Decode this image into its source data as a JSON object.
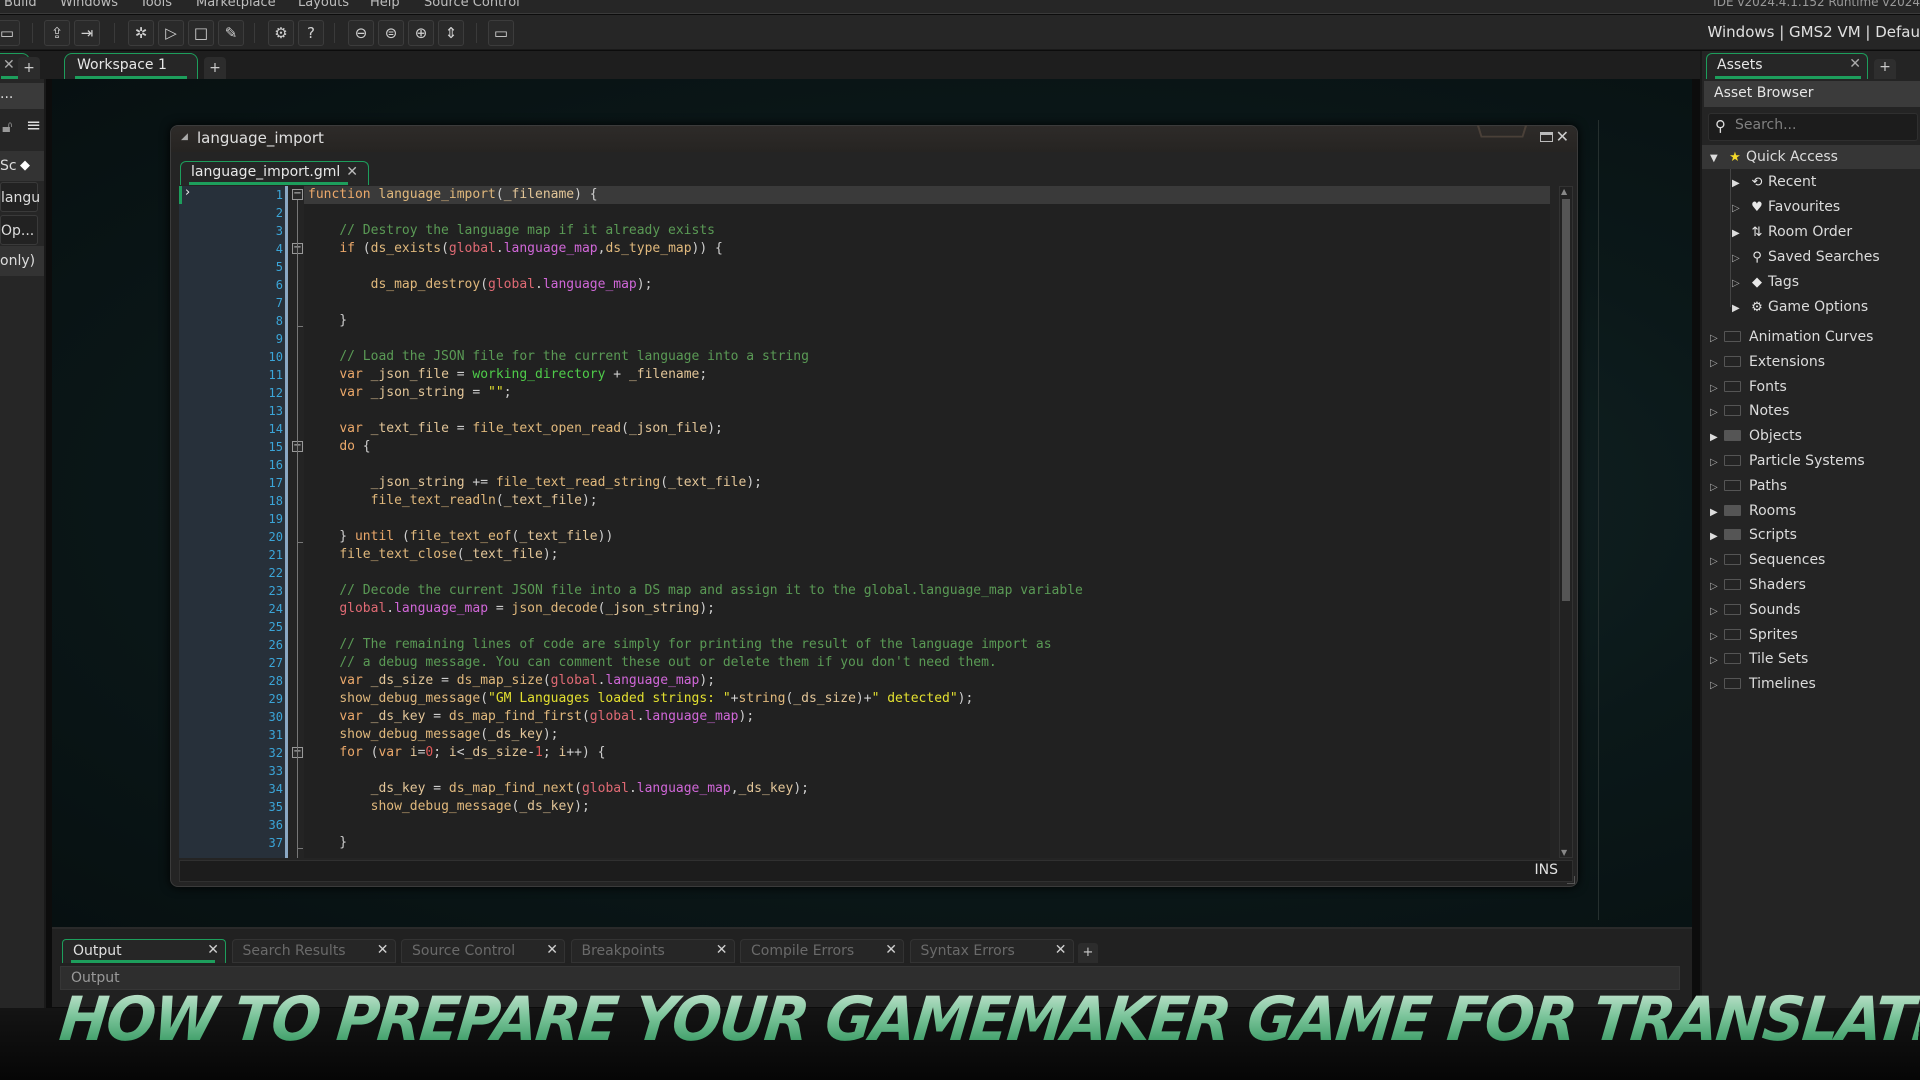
{
  "menu": {
    "items": [
      "Build",
      "Windows",
      "Tools",
      "Marketplace",
      "Layouts",
      "Help",
      "Source Control"
    ],
    "version_text": "IDE v2024.4.1.152  Runtime v2024"
  },
  "toolbar": {
    "buttons": [
      {
        "name": "save-icon",
        "glyph": "▭"
      },
      {
        "name": "export-icon",
        "glyph": "⇪"
      },
      {
        "name": "import-icon",
        "glyph": "⇥"
      },
      {
        "name": "debug-icon",
        "glyph": "✲"
      },
      {
        "name": "run-icon",
        "glyph": "▷"
      },
      {
        "name": "stop-icon",
        "glyph": "□"
      },
      {
        "name": "clean-icon",
        "glyph": "✎"
      },
      {
        "name": "settings-icon",
        "glyph": "⚙"
      },
      {
        "name": "help-icon",
        "glyph": "?"
      },
      {
        "name": "zoom-out-icon",
        "glyph": "⊖"
      },
      {
        "name": "zoom-reset-icon",
        "glyph": "⊜"
      },
      {
        "name": "zoom-in-icon",
        "glyph": "⊕"
      },
      {
        "name": "fit-icon",
        "glyph": "⇕"
      },
      {
        "name": "target-device-icon",
        "glyph": "▭"
      }
    ],
    "target_text": "Windows | GMS2 VM | Defau"
  },
  "tabs": {
    "workspace": "Workspace 1",
    "plus": "+"
  },
  "left_panel": {
    "search_fragment": "...",
    "rows": [
      "Sc",
      "langu",
      "Op...",
      "only)"
    ]
  },
  "code_window": {
    "title": "language_import",
    "file_tab": "language_import.gml",
    "close": "✕",
    "status": "INS",
    "lines": [
      [
        [
          "kw",
          "function "
        ],
        [
          "fn",
          "language_import"
        ],
        [
          "op",
          "("
        ],
        [
          "id",
          "_filename"
        ],
        [
          "op",
          ") {"
        ]
      ],
      [],
      [
        [
          "op",
          "    "
        ],
        [
          "cm",
          "// Destroy the language map if it already exists"
        ]
      ],
      [
        [
          "op",
          "    "
        ],
        [
          "kw",
          "if "
        ],
        [
          "op",
          "("
        ],
        [
          "fn",
          "ds_exists"
        ],
        [
          "op",
          "("
        ],
        [
          "gl",
          "global"
        ],
        [
          "op",
          "."
        ],
        [
          "gv",
          "language_map"
        ],
        [
          "op",
          ","
        ],
        [
          "fn",
          "ds_type_map"
        ],
        [
          "op",
          ")) {"
        ]
      ],
      [],
      [
        [
          "op",
          "        "
        ],
        [
          "fn",
          "ds_map_destroy"
        ],
        [
          "op",
          "("
        ],
        [
          "gl",
          "global"
        ],
        [
          "op",
          "."
        ],
        [
          "gv",
          "language_map"
        ],
        [
          "op",
          ");"
        ]
      ],
      [],
      [
        [
          "op",
          "    }"
        ]
      ],
      [],
      [
        [
          "op",
          "    "
        ],
        [
          "cm",
          "// Load the JSON file for the current language into a string"
        ]
      ],
      [
        [
          "op",
          "    "
        ],
        [
          "kw",
          "var "
        ],
        [
          "id",
          "_json_file"
        ],
        [
          "op",
          " = "
        ],
        [
          "bi",
          "working_directory"
        ],
        [
          "op",
          " + "
        ],
        [
          "id",
          "_filename"
        ],
        [
          "op",
          ";"
        ]
      ],
      [
        [
          "op",
          "    "
        ],
        [
          "kw",
          "var "
        ],
        [
          "id",
          "_json_string"
        ],
        [
          "op",
          " = "
        ],
        [
          "st",
          "\"\""
        ],
        [
          "op",
          ";"
        ]
      ],
      [],
      [
        [
          "op",
          "    "
        ],
        [
          "kw",
          "var "
        ],
        [
          "id",
          "_text_file"
        ],
        [
          "op",
          " = "
        ],
        [
          "fn",
          "file_text_open_read"
        ],
        [
          "op",
          "("
        ],
        [
          "id",
          "_json_file"
        ],
        [
          "op",
          ");"
        ]
      ],
      [
        [
          "op",
          "    "
        ],
        [
          "kw",
          "do "
        ],
        [
          "op",
          "{"
        ]
      ],
      [],
      [
        [
          "op",
          "        "
        ],
        [
          "id",
          "_json_string"
        ],
        [
          "op",
          " += "
        ],
        [
          "fn",
          "file_text_read_string"
        ],
        [
          "op",
          "("
        ],
        [
          "id",
          "_text_file"
        ],
        [
          "op",
          ");"
        ]
      ],
      [
        [
          "op",
          "        "
        ],
        [
          "fn",
          "file_text_readln"
        ],
        [
          "op",
          "("
        ],
        [
          "id",
          "_text_file"
        ],
        [
          "op",
          ");"
        ]
      ],
      [],
      [
        [
          "op",
          "    } "
        ],
        [
          "kw",
          "until "
        ],
        [
          "op",
          "("
        ],
        [
          "fn",
          "file_text_eof"
        ],
        [
          "op",
          "("
        ],
        [
          "id",
          "_text_file"
        ],
        [
          "op",
          "))"
        ]
      ],
      [
        [
          "op",
          "    "
        ],
        [
          "fn",
          "file_text_close"
        ],
        [
          "op",
          "("
        ],
        [
          "id",
          "_text_file"
        ],
        [
          "op",
          ");"
        ]
      ],
      [],
      [
        [
          "op",
          "    "
        ],
        [
          "cm",
          "// Decode the current JSON file into a DS map and assign it to the global.language_map variable"
        ]
      ],
      [
        [
          "op",
          "    "
        ],
        [
          "gl",
          "global"
        ],
        [
          "op",
          "."
        ],
        [
          "gv",
          "language_map"
        ],
        [
          "op",
          " = "
        ],
        [
          "fn",
          "json_decode"
        ],
        [
          "op",
          "("
        ],
        [
          "id",
          "_json_string"
        ],
        [
          "op",
          ");"
        ]
      ],
      [],
      [
        [
          "op",
          "    "
        ],
        [
          "cm",
          "// The remaining lines of code are simply for printing the result of the language import as"
        ]
      ],
      [
        [
          "op",
          "    "
        ],
        [
          "cm",
          "// a debug message. You can comment these out or delete them if you don't need them."
        ]
      ],
      [
        [
          "op",
          "    "
        ],
        [
          "kw",
          "var "
        ],
        [
          "id",
          "_ds_size"
        ],
        [
          "op",
          " = "
        ],
        [
          "fn",
          "ds_map_size"
        ],
        [
          "op",
          "("
        ],
        [
          "gl",
          "global"
        ],
        [
          "op",
          "."
        ],
        [
          "gv",
          "language_map"
        ],
        [
          "op",
          ");"
        ]
      ],
      [
        [
          "op",
          "    "
        ],
        [
          "fn",
          "show_debug_message"
        ],
        [
          "op",
          "("
        ],
        [
          "st",
          "\"GM Languages loaded strings: \""
        ],
        [
          "op",
          "+"
        ],
        [
          "fn",
          "string"
        ],
        [
          "op",
          "("
        ],
        [
          "id",
          "_ds_size"
        ],
        [
          "op",
          ")+"
        ],
        [
          "st",
          "\" detected\""
        ],
        [
          "op",
          ");"
        ]
      ],
      [
        [
          "op",
          "    "
        ],
        [
          "kw",
          "var "
        ],
        [
          "id",
          "_ds_key"
        ],
        [
          "op",
          " = "
        ],
        [
          "fn",
          "ds_map_find_first"
        ],
        [
          "op",
          "("
        ],
        [
          "gl",
          "global"
        ],
        [
          "op",
          "."
        ],
        [
          "gv",
          "language_map"
        ],
        [
          "op",
          ");"
        ]
      ],
      [
        [
          "op",
          "    "
        ],
        [
          "fn",
          "show_debug_message"
        ],
        [
          "op",
          "("
        ],
        [
          "id",
          "_ds_key"
        ],
        [
          "op",
          ");"
        ]
      ],
      [
        [
          "op",
          "    "
        ],
        [
          "kw",
          "for "
        ],
        [
          "op",
          "("
        ],
        [
          "kw",
          "var "
        ],
        [
          "id",
          "i"
        ],
        [
          "op",
          "="
        ],
        [
          "nm",
          "0"
        ],
        [
          "op",
          "; "
        ],
        [
          "id",
          "i"
        ],
        [
          "op",
          "<"
        ],
        [
          "id",
          "_ds_size"
        ],
        [
          "op",
          "-"
        ],
        [
          "nm",
          "1"
        ],
        [
          "op",
          "; "
        ],
        [
          "id",
          "i"
        ],
        [
          "op",
          "++) {"
        ]
      ],
      [],
      [
        [
          "op",
          "        "
        ],
        [
          "id",
          "_ds_key"
        ],
        [
          "op",
          " = "
        ],
        [
          "fn",
          "ds_map_find_next"
        ],
        [
          "op",
          "("
        ],
        [
          "gl",
          "global"
        ],
        [
          "op",
          "."
        ],
        [
          "gv",
          "language_map"
        ],
        [
          "op",
          ","
        ],
        [
          "id",
          "_ds_key"
        ],
        [
          "op",
          ");"
        ]
      ],
      [
        [
          "op",
          "        "
        ],
        [
          "fn",
          "show_debug_message"
        ],
        [
          "op",
          "("
        ],
        [
          "id",
          "_ds_key"
        ],
        [
          "op",
          ");"
        ]
      ],
      [],
      [
        [
          "op",
          "    }"
        ]
      ]
    ],
    "folds": [
      1,
      4,
      15,
      32
    ],
    "fold_ends": [
      8,
      20,
      37
    ]
  },
  "assets": {
    "tab_label": "Assets",
    "header": "Asset Browser",
    "search_placeholder": "Search...",
    "quick_access": {
      "label": "Quick Access",
      "items": [
        {
          "label": "Recent",
          "icon": "⟲",
          "icon_name": "recent-icon",
          "arrow": "filled"
        },
        {
          "label": "Favourites",
          "icon": "♥",
          "icon_name": "heart-icon",
          "arrow": "hollow"
        },
        {
          "label": "Room Order",
          "icon": "⇅",
          "icon_name": "room-order-icon",
          "arrow": "filled"
        },
        {
          "label": "Saved Searches",
          "icon": "⚲",
          "icon_name": "search-icon",
          "arrow": "hollow"
        },
        {
          "label": "Tags",
          "icon": "◆",
          "icon_name": "tag-icon",
          "arrow": "hollow"
        },
        {
          "label": "Game Options",
          "icon": "⚙",
          "icon_name": "gear-icon",
          "arrow": "filled"
        }
      ]
    },
    "folders": [
      {
        "label": "Animation Curves",
        "filled": false
      },
      {
        "label": "Extensions",
        "filled": false
      },
      {
        "label": "Fonts",
        "filled": false
      },
      {
        "label": "Notes",
        "filled": false
      },
      {
        "label": "Objects",
        "filled": true
      },
      {
        "label": "Particle Systems",
        "filled": false
      },
      {
        "label": "Paths",
        "filled": false
      },
      {
        "label": "Rooms",
        "filled": true
      },
      {
        "label": "Scripts",
        "filled": true
      },
      {
        "label": "Sequences",
        "filled": false
      },
      {
        "label": "Shaders",
        "filled": false
      },
      {
        "label": "Sounds",
        "filled": false
      },
      {
        "label": "Sprites",
        "filled": false
      },
      {
        "label": "Tile Sets",
        "filled": false
      },
      {
        "label": "Timelines",
        "filled": false
      }
    ]
  },
  "output_panel": {
    "tabs": [
      "Output",
      "Search Results",
      "Source Control",
      "Breakpoints",
      "Compile Errors",
      "Syntax Errors"
    ],
    "active_tab": 0,
    "content_label": "Output"
  },
  "headline": "HOW TO PREPARE YOUR GAMEMAKER GAME FOR TRANSLATION",
  "colors": {
    "accent": "#1d9e5c",
    "line_numbers": "#3ba5d8",
    "comment": "#5a9a55",
    "keyword": "#eba86a",
    "global": "#e06a74",
    "global_var": "#d067d8",
    "builtin": "#4fcc4a",
    "string": "#e3e030"
  }
}
